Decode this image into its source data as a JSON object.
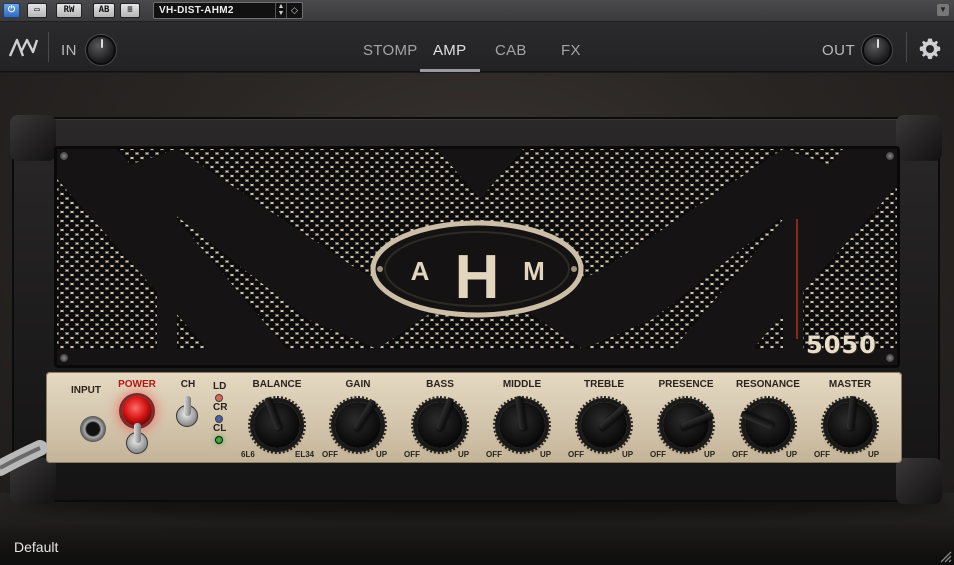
{
  "host_toolbar": {
    "power_icon": "power-icon",
    "compare_icon": "compare-icon",
    "rw_label": "RW",
    "ab_label": "AB",
    "menu_icon": "list-icon",
    "preset_name": "VH-DIST-AHM2"
  },
  "header": {
    "in_label": "IN",
    "out_label": "OUT",
    "tabs": [
      {
        "label": "STOMP",
        "active": false
      },
      {
        "label": "AMP",
        "active": true
      },
      {
        "label": "CAB",
        "active": false
      },
      {
        "label": "FX",
        "active": false
      }
    ]
  },
  "amp": {
    "brand_letters": [
      "A",
      "H",
      "M"
    ],
    "model": "5050",
    "input_label": "INPUT",
    "power_label": "POWER",
    "ch_label": "CH",
    "channels": [
      {
        "label": "LD",
        "color": "#d9483b",
        "lit": false
      },
      {
        "label": "CR",
        "color": "#1d3fa6",
        "lit": false
      },
      {
        "label": "CL",
        "color": "#3fa83a",
        "lit": true
      }
    ],
    "knobs": [
      {
        "label": "BALANCE",
        "left": "6L6",
        "right": "EL34",
        "value": 0.42
      },
      {
        "label": "GAIN",
        "left": "OFF",
        "right": "UP",
        "value": 0.62
      },
      {
        "label": "BASS",
        "left": "OFF",
        "right": "UP",
        "value": 0.58
      },
      {
        "label": "MIDDLE",
        "left": "OFF",
        "right": "UP",
        "value": 0.47
      },
      {
        "label": "TREBLE",
        "left": "OFF",
        "right": "UP",
        "value": 0.68
      },
      {
        "label": "PRESENCE",
        "left": "OFF",
        "right": "UP",
        "value": 0.75
      },
      {
        "label": "RESONANCE",
        "left": "OFF",
        "right": "UP",
        "value": 0.25
      },
      {
        "label": "MASTER",
        "left": "OFF",
        "right": "UP",
        "value": 0.52
      }
    ]
  },
  "footer": {
    "preset_label": "Default"
  }
}
